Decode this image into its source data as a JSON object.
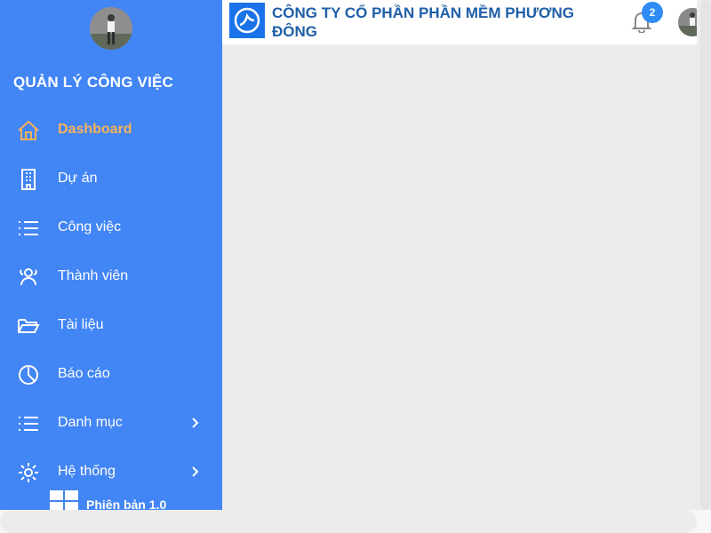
{
  "sidebar": {
    "title": "QUẢN LÝ CÔNG VIỆC",
    "items": [
      {
        "label": "Dashboard",
        "icon": "home-icon",
        "active": true
      },
      {
        "label": "Dự án",
        "icon": "building-icon"
      },
      {
        "label": "Công việc",
        "icon": "list-icon"
      },
      {
        "label": "Thành viên",
        "icon": "users-icon"
      },
      {
        "label": "Tài liệu",
        "icon": "folder-open-icon"
      },
      {
        "label": "Báo cáo",
        "icon": "pie-chart-icon"
      },
      {
        "label": "Danh mục",
        "icon": "list-icon",
        "has_submenu": true
      },
      {
        "label": "Hệ thống",
        "icon": "gear-icon",
        "has_submenu": true
      }
    ],
    "version": "Phiên bản 1.0"
  },
  "header": {
    "company_name": "CÔNG TY CỔ PHẦN PHẦN MỀM PHƯƠNG ĐÔNG",
    "notification_count": "2"
  },
  "colors": {
    "sidebar_bg": "#4285f4",
    "active_item": "#f6b25a",
    "company_text": "#1e5fa8",
    "badge": "#2f8cf5",
    "content_bg": "#ececec"
  }
}
